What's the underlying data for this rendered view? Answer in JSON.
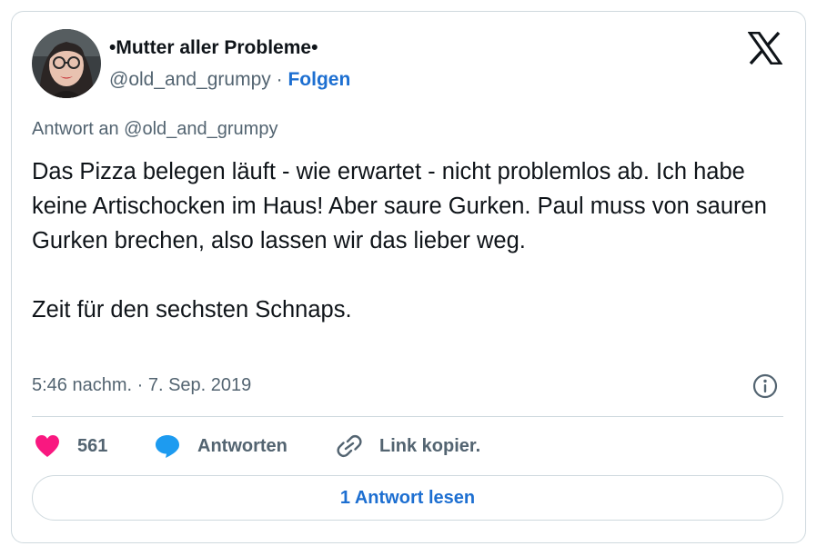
{
  "author": {
    "display_name": "•Mutter aller Probleme•",
    "handle": "@old_and_grumpy",
    "separator": "·",
    "follow_label": "Folgen"
  },
  "reply_to": "Antwort an @old_and_grumpy",
  "tweet": {
    "paragraph_1": "Das Pizza belegen läuft - wie erwartet - nicht problemlos ab. Ich habe keine Artischocken im Haus! Aber saure Gurken. Paul muss von sauren Gurken brechen, also lassen wir das lieber weg.",
    "paragraph_2": "Zeit für den sechsten Schnaps.",
    "timestamp": "5:46 nachm. · 7. Sep. 2019"
  },
  "actions": {
    "like_count": "561",
    "reply_label": "Antworten",
    "copy_label": "Link kopier."
  },
  "read_replies_label": "1 Antwort lesen",
  "colors": {
    "like": "#f91880",
    "reply": "#1d9bf0",
    "link": "#1d6fd1",
    "muted": "#536471",
    "border": "#cfd9de"
  },
  "icons": [
    "x-logo-icon",
    "info-icon",
    "heart-icon",
    "speech-bubble-icon",
    "link-icon"
  ]
}
